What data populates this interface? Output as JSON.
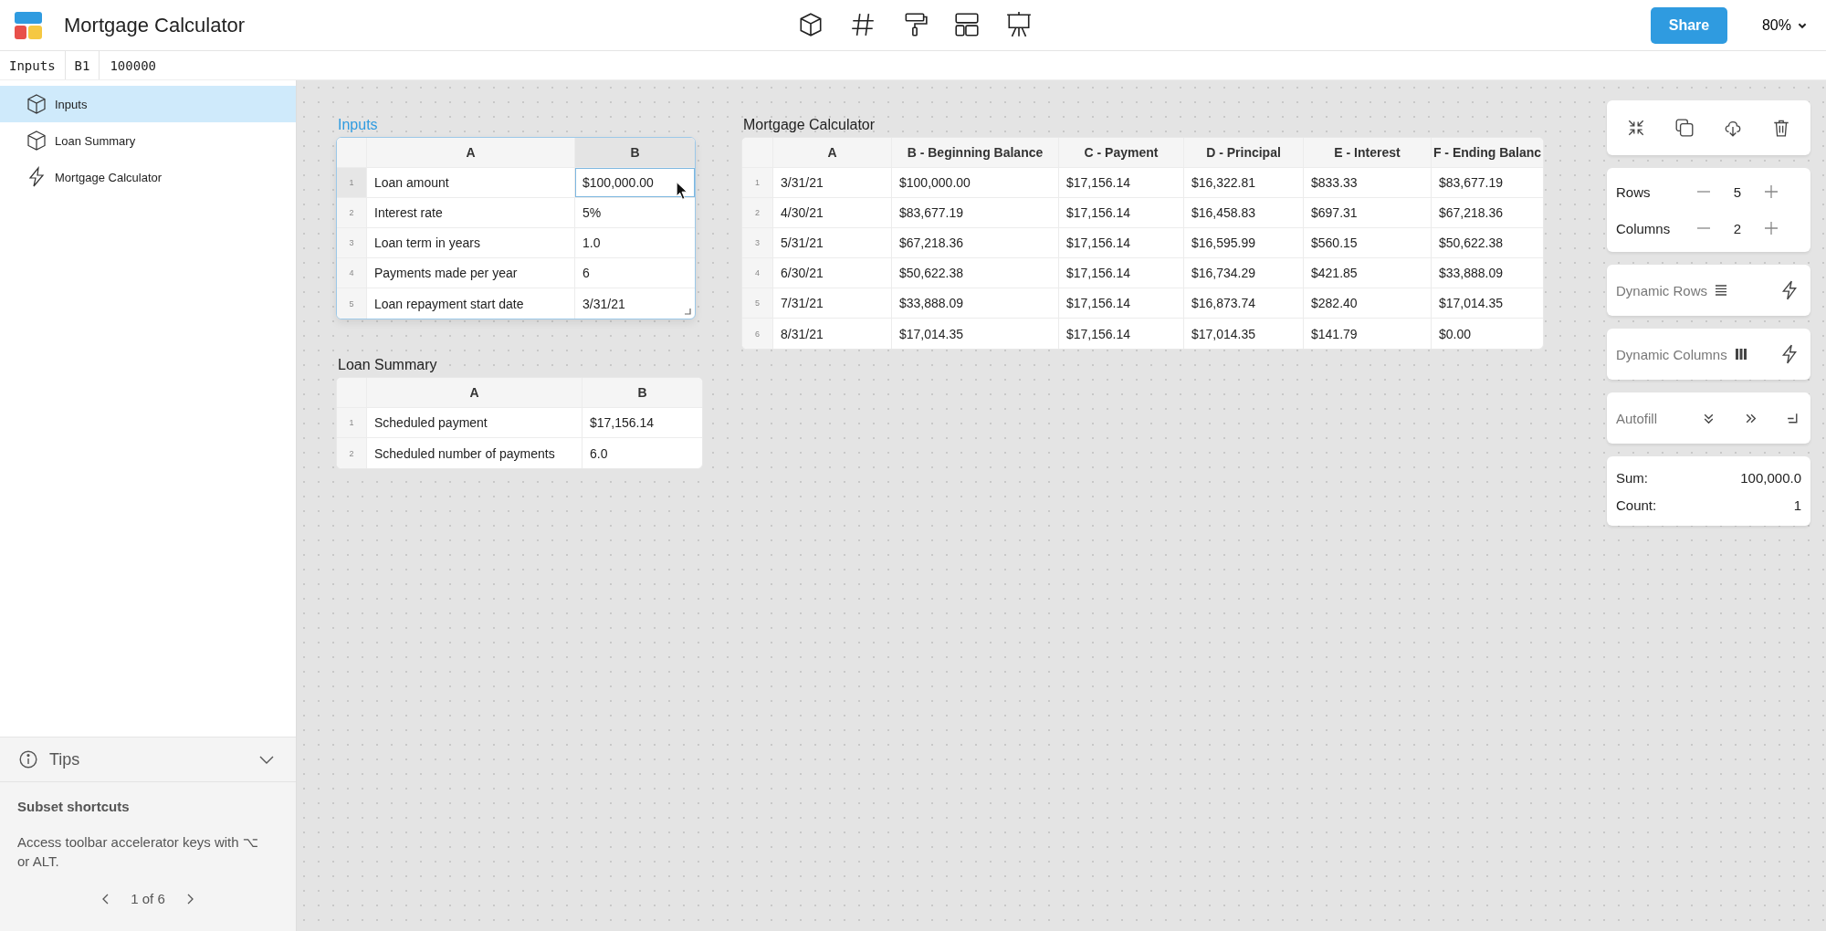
{
  "app": {
    "title": "Mortgage Calculator"
  },
  "toolbar": [
    {
      "kind": "cube"
    },
    {
      "kind": "hash"
    },
    {
      "kind": "roller"
    },
    {
      "kind": "layout"
    },
    {
      "kind": "easel"
    }
  ],
  "share_button": "Share",
  "zoom": "80%",
  "formula_bar": {
    "sheet": "Inputs",
    "cell": "B1",
    "value": "100000"
  },
  "sidebar": {
    "items": [
      {
        "label": "Inputs",
        "kind": "table",
        "selected": true
      },
      {
        "label": "Loan Summary",
        "kind": "table",
        "selected": false
      },
      {
        "label": "Mortgage Calculator",
        "kind": "dynamic",
        "selected": false
      }
    ]
  },
  "tips": {
    "title": "Tips",
    "expanded": true,
    "heading": "Subset shortcuts",
    "body": "Access toolbar accelerator keys with ⌥ or ALT.",
    "pager": "1 of 6"
  },
  "sheets": [
    {
      "title": "Inputs",
      "selected": true,
      "columns": [
        {
          "label": "A",
          "selected": false
        },
        {
          "label": "B",
          "selected": true
        }
      ],
      "rows": [
        {
          "number": "1",
          "selected": true,
          "cells": [
            "Loan amount",
            "$100,000.00"
          ]
        },
        {
          "number": "2",
          "selected": false,
          "cells": [
            "Interest rate",
            "5%"
          ]
        },
        {
          "number": "3",
          "selected": false,
          "cells": [
            "Loan term in years",
            "1.0"
          ]
        },
        {
          "number": "4",
          "selected": false,
          "cells": [
            "Payments made per year",
            "6"
          ]
        },
        {
          "number": "5",
          "selected": false,
          "cells": [
            "Loan repayment start date",
            "3/31/21"
          ]
        }
      ]
    },
    {
      "title": "Loan Summary",
      "selected": false,
      "columns": [
        {
          "label": "A",
          "selected": false
        },
        {
          "label": "B",
          "selected": false
        }
      ],
      "rows": [
        {
          "number": "1",
          "selected": false,
          "cells": [
            "Scheduled payment",
            "$17,156.14"
          ]
        },
        {
          "number": "2",
          "selected": false,
          "cells": [
            "Scheduled number of payments",
            "6.0"
          ]
        }
      ]
    },
    {
      "title": "Mortgage Calculator",
      "selected": false,
      "columns": [
        {
          "label": "A",
          "selected": false
        },
        {
          "label": "B - Beginning Balance",
          "selected": false
        },
        {
          "label": "C - Payment",
          "selected": false
        },
        {
          "label": "D - Principal",
          "selected": false
        },
        {
          "label": "E - Interest",
          "selected": false
        },
        {
          "label": "F - Ending Balanc",
          "selected": false
        }
      ],
      "rows": [
        {
          "number": "1",
          "selected": false,
          "cells": [
            "3/31/21",
            "$100,000.00",
            "$17,156.14",
            "$16,322.81",
            "$833.33",
            "$83,677.19"
          ]
        },
        {
          "number": "2",
          "selected": false,
          "cells": [
            "4/30/21",
            "$83,677.19",
            "$17,156.14",
            "$16,458.83",
            "$697.31",
            "$67,218.36"
          ]
        },
        {
          "number": "3",
          "selected": false,
          "cells": [
            "5/31/21",
            "$67,218.36",
            "$17,156.14",
            "$16,595.99",
            "$560.15",
            "$50,622.38"
          ]
        },
        {
          "number": "4",
          "selected": false,
          "cells": [
            "6/30/21",
            "$50,622.38",
            "$17,156.14",
            "$16,734.29",
            "$421.85",
            "$33,888.09"
          ]
        },
        {
          "number": "5",
          "selected": false,
          "cells": [
            "7/31/21",
            "$33,888.09",
            "$17,156.14",
            "$16,873.74",
            "$282.40",
            "$17,014.35"
          ]
        },
        {
          "number": "6",
          "selected": false,
          "cells": [
            "8/31/21",
            "$17,014.35",
            "$17,156.14",
            "$17,014.35",
            "$141.79",
            "$0.00"
          ]
        }
      ]
    }
  ],
  "panel": {
    "actions": [
      {
        "kind": "collapse"
      },
      {
        "kind": "copy"
      },
      {
        "kind": "download"
      },
      {
        "kind": "trash"
      }
    ],
    "steppers": [
      {
        "label": "Rows",
        "value": "5"
      },
      {
        "label": "Columns",
        "value": "2"
      }
    ],
    "dynamic": [
      {
        "label": "Dynamic Rows",
        "kind": "rows",
        "disabled": true
      },
      {
        "label": "Dynamic Columns",
        "kind": "columns",
        "disabled": true
      }
    ],
    "autofill": {
      "label": "Autofill",
      "disabled": true
    },
    "stats": [
      {
        "label": "Sum:",
        "value": "100,000.0"
      },
      {
        "label": "Count:",
        "value": "1"
      }
    ]
  }
}
